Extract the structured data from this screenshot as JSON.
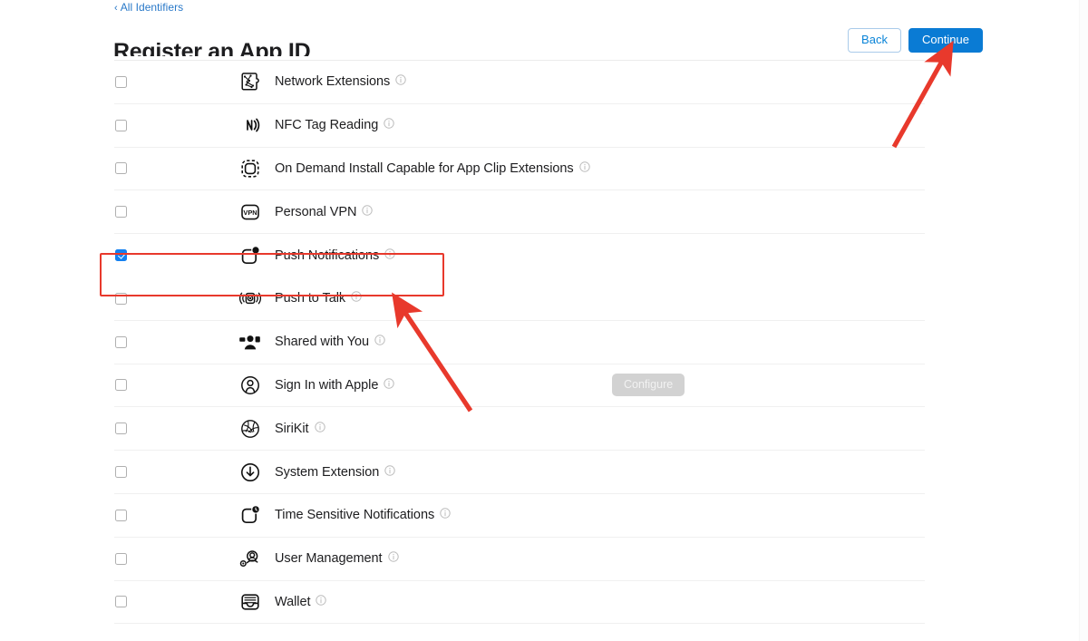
{
  "breadcrumb": {
    "chevron": "‹",
    "label": "All Identifiers"
  },
  "header": {
    "title": "Register an App ID",
    "back_label": "Back",
    "continue_label": "Continue"
  },
  "capabilities": [
    {
      "label": "",
      "icon": "partial-row-icon",
      "checked": false,
      "partial": true,
      "configure": null
    },
    {
      "label": "Network Extensions",
      "icon": "network-extensions-icon",
      "checked": false,
      "partial": false,
      "configure": null
    },
    {
      "label": "NFC Tag Reading",
      "icon": "nfc-tag-reading-icon",
      "checked": false,
      "partial": false,
      "configure": null
    },
    {
      "label": "On Demand Install Capable for App Clip Extensions",
      "icon": "on-demand-install-icon",
      "checked": false,
      "partial": false,
      "configure": null
    },
    {
      "label": "Personal VPN",
      "icon": "personal-vpn-icon",
      "checked": false,
      "partial": false,
      "configure": null
    },
    {
      "label": "Push Notifications",
      "icon": "push-notifications-icon",
      "checked": true,
      "partial": false,
      "configure": null,
      "highlighted": true
    },
    {
      "label": "Push to Talk",
      "icon": "push-to-talk-icon",
      "checked": false,
      "partial": false,
      "configure": null
    },
    {
      "label": "Shared with You",
      "icon": "shared-with-you-icon",
      "checked": false,
      "partial": false,
      "configure": null
    },
    {
      "label": "Sign In with Apple",
      "icon": "sign-in-with-apple-icon",
      "checked": false,
      "partial": false,
      "configure": "Configure"
    },
    {
      "label": "SiriKit",
      "icon": "sirikit-icon",
      "checked": false,
      "partial": false,
      "configure": null
    },
    {
      "label": "System Extension",
      "icon": "system-extension-icon",
      "checked": false,
      "partial": false,
      "configure": null
    },
    {
      "label": "Time Sensitive Notifications",
      "icon": "time-sensitive-notifications-icon",
      "checked": false,
      "partial": false,
      "configure": null
    },
    {
      "label": "User Management",
      "icon": "user-management-icon",
      "checked": false,
      "partial": false,
      "configure": null
    },
    {
      "label": "Wallet",
      "icon": "wallet-icon",
      "checked": false,
      "partial": false,
      "configure": null
    }
  ],
  "annotations": {
    "highlight_color": "#e8392c",
    "highlight_target": "Push Notifications",
    "arrow_targets": [
      "Continue",
      "Push Notifications"
    ]
  },
  "colors": {
    "primary_button": "#0a7bd4",
    "link": "#2878c8",
    "checkbox_checked": "#1480f0",
    "annotation": "#e8392c",
    "configure_button": "#d2d2d2"
  }
}
